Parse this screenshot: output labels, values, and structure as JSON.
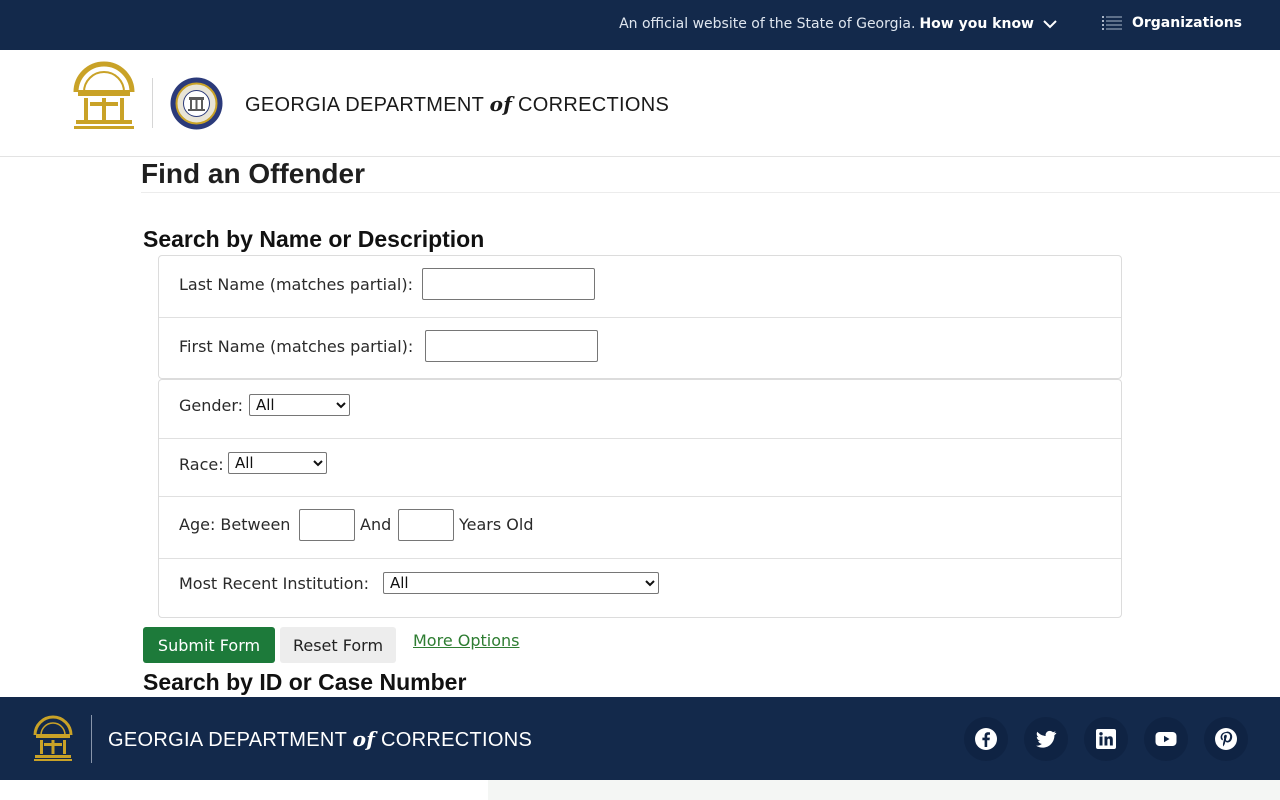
{
  "topbar": {
    "official_text": "An official website of the State of Georgia.",
    "how_you_know": "How you know",
    "organizations": "Organizations"
  },
  "header": {
    "title_part1": "GEORGIA DEPARTMENT",
    "title_of": "of",
    "title_part2": "CORRECTIONS"
  },
  "page": {
    "title": "Find an Offender"
  },
  "search_name": {
    "heading": "Search by Name or Description",
    "last_name_label": "Last Name (matches partial):",
    "last_name_value": "",
    "first_name_label": "First Name (matches partial):",
    "first_name_value": "",
    "gender_label": "Gender:",
    "gender_selected": "All",
    "race_label": "Race:",
    "race_selected": "All",
    "age_label": "Age: Between",
    "age_and": "And",
    "age_suffix": "Years Old",
    "age_min": "",
    "age_max": "",
    "institution_label": "Most Recent Institution:",
    "institution_selected": "All"
  },
  "actions": {
    "submit": "Submit Form",
    "reset": "Reset Form",
    "more_options": "More Options"
  },
  "search_id": {
    "heading": "Search by ID or Case Number"
  },
  "footer": {
    "title_part1": "GEORGIA DEPARTMENT",
    "title_of": "of",
    "title_part2": "CORRECTIONS",
    "social_icons": [
      "facebook-icon",
      "twitter-icon",
      "linkedin-icon",
      "youtube-icon",
      "pinterest-icon"
    ]
  },
  "colors": {
    "navy": "#13294b",
    "gold": "#c9a227",
    "green_button": "#1d7a3a",
    "link_green": "#2e7d32"
  }
}
